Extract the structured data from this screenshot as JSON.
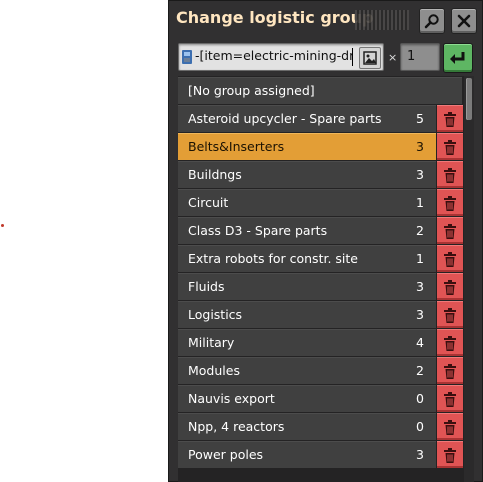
{
  "dialog": {
    "title": "Change logistic group"
  },
  "toolbar": {
    "text_value": "-[item=electric-mining-dril",
    "multiply_sign": "×",
    "count_value": "1"
  },
  "list": {
    "first_item": "[No group assigned]",
    "rows": [
      {
        "label": "Asteroid upcycler - Spare parts",
        "count": "5",
        "selected": false
      },
      {
        "label": "Belts&Inserters",
        "count": "3",
        "selected": true
      },
      {
        "label": "Buildngs",
        "count": "3",
        "selected": false
      },
      {
        "label": "Circuit",
        "count": "1",
        "selected": false
      },
      {
        "label": "Class D3 - Spare parts",
        "count": "2",
        "selected": false
      },
      {
        "label": "Extra robots for constr. site",
        "count": "1",
        "selected": false
      },
      {
        "label": "Fluids",
        "count": "3",
        "selected": false
      },
      {
        "label": "Logistics",
        "count": "3",
        "selected": false
      },
      {
        "label": "Military",
        "count": "4",
        "selected": false
      },
      {
        "label": "Modules",
        "count": "2",
        "selected": false
      },
      {
        "label": "Nauvis export",
        "count": "0",
        "selected": false
      },
      {
        "label": "Npp, 4 reactors",
        "count": "0",
        "selected": false
      },
      {
        "label": "Power poles",
        "count": "3",
        "selected": false
      }
    ]
  },
  "icons": {
    "search": "search-icon",
    "close": "close-icon",
    "item": "electric-mining-drill-icon",
    "image": "image-icon",
    "confirm": "enter-arrow-icon",
    "delete": "trash-icon"
  },
  "colors": {
    "panel_bg": "#313031",
    "title": "#ffe6c0",
    "row_bg": "#404040",
    "selected_row": "#e39e36",
    "delete_button": "#e05454",
    "confirm_button": "#5eb663"
  }
}
